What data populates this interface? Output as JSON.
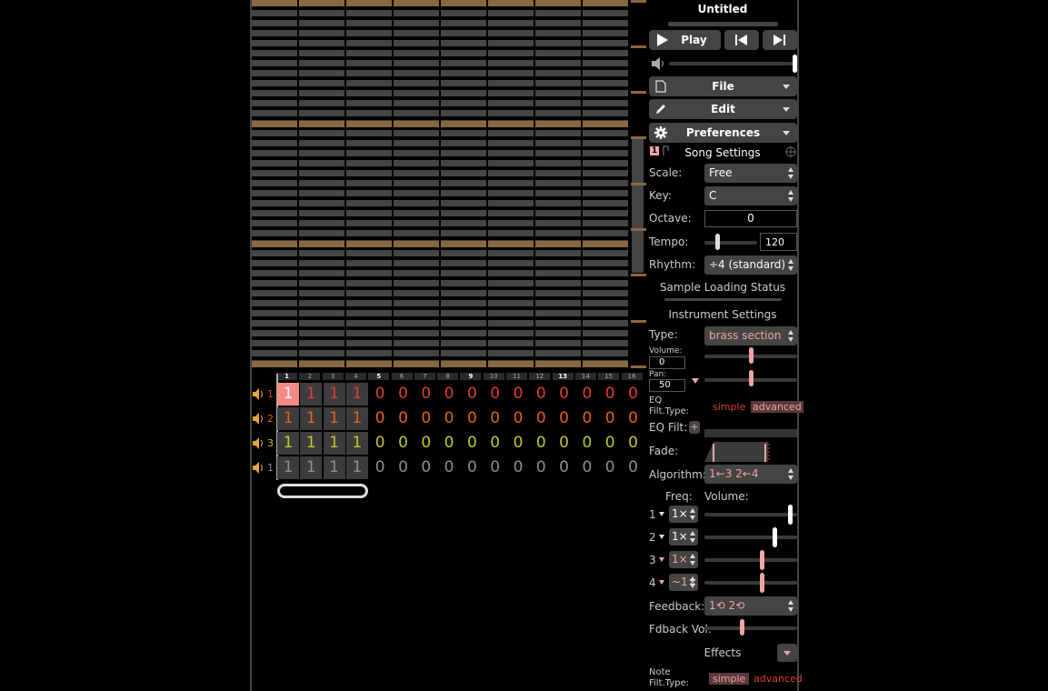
{
  "title": "Untitled",
  "transport": {
    "play_label": "Play"
  },
  "menus": {
    "file": "File",
    "edit": "Edit",
    "preferences": "Preferences"
  },
  "song_settings": {
    "header": "Song Settings",
    "badge": "1",
    "scale_label": "Scale:",
    "scale_value": "Free",
    "key_label": "Key:",
    "key_value": "C",
    "octave_label": "Octave:",
    "octave_value": "0",
    "tempo_label": "Tempo:",
    "tempo_value": "120",
    "rhythm_label": "Rhythm:",
    "rhythm_value": "÷4 (standard)"
  },
  "sample_loading_status": "Sample Loading Status",
  "instrument_settings": {
    "header": "Instrument Settings",
    "type_label": "Type:",
    "type_value": "brass section",
    "volume_label": "Volume:",
    "volume_value": "0",
    "pan_label": "Pan:",
    "pan_value": "50",
    "eq_filt_type_label": "EQ Filt.Type:",
    "simple_label": "simple",
    "advanced_label": "advanced",
    "eq_filt_label": "EQ Filt:",
    "eq_plus": "+",
    "fade_label": "Fade:",
    "algorithm_label": "Algorithm:",
    "algorithm_value": "1←3  2←4",
    "freq_label": "Freq:",
    "op_volume_label": "Volume:",
    "operators": [
      {
        "num": "1",
        "freq": "1×",
        "volume": 0.95
      },
      {
        "num": "2",
        "freq": "1×",
        "volume": 0.77
      },
      {
        "num": "3",
        "freq": "1×",
        "volume": 0.63
      },
      {
        "num": "4",
        "freq": "~1×",
        "volume": 0.63
      }
    ],
    "feedback_label": "Feedback:",
    "feedback_value": "1⟲  2⟲",
    "fdback_vol_label": "Fdback Vol:",
    "effects_label": "Effects",
    "note_filt_type_label": "Note Filt.Type:",
    "note_simple_label": "simple",
    "note_advanced_label": "advanced"
  },
  "bar_numbers": [
    "1",
    "2",
    "3",
    "4",
    "5",
    "6",
    "7",
    "8",
    "9",
    "10",
    "11",
    "12",
    "13",
    "14",
    "15",
    "16"
  ],
  "channels": [
    {
      "num": "1",
      "color": "#e03c32",
      "cells": [
        "1",
        "1",
        "1",
        "1",
        "0",
        "0",
        "0",
        "0",
        "0",
        "0",
        "0",
        "0",
        "0",
        "0",
        "0",
        "0"
      ]
    },
    {
      "num": "2",
      "color": "#e2611a",
      "cells": [
        "1",
        "1",
        "1",
        "1",
        "0",
        "0",
        "0",
        "0",
        "0",
        "0",
        "0",
        "0",
        "0",
        "0",
        "0",
        "0"
      ]
    },
    {
      "num": "3",
      "color": "#c3c72a",
      "cells": [
        "1",
        "1",
        "1",
        "1",
        "0",
        "0",
        "0",
        "0",
        "0",
        "0",
        "0",
        "0",
        "0",
        "0",
        "0",
        "0"
      ]
    },
    {
      "num": "1",
      "color": "#8d8d8d",
      "cells": [
        "1",
        "1",
        "1",
        "1",
        "0",
        "0",
        "0",
        "0",
        "0",
        "0",
        "0",
        "0",
        "0",
        "0",
        "0",
        "0"
      ]
    }
  ],
  "colors": {
    "accent_pink": "#f2a3a3",
    "octave_row": "#8a6840",
    "note_row": "#464646"
  }
}
